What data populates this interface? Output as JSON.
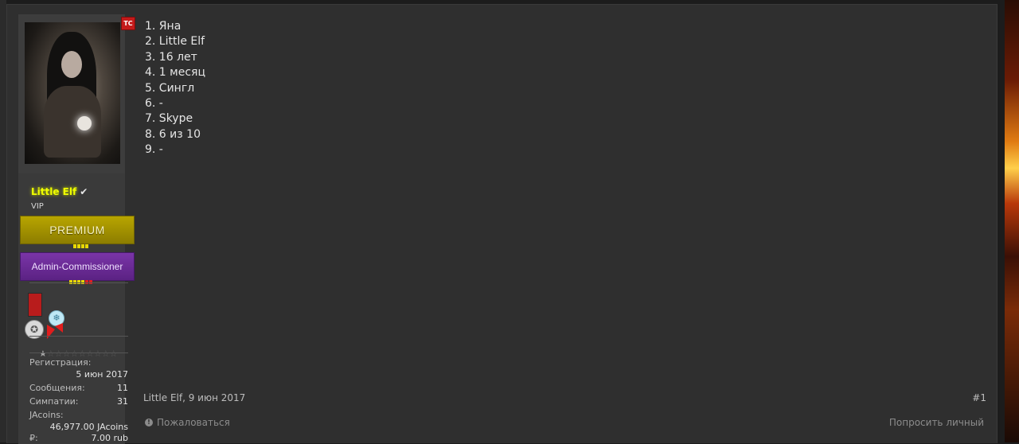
{
  "post": {
    "tc_badge": "ТС",
    "user": {
      "name": "Little Elf",
      "title": "VIP",
      "banner_premium": "PREMIUM",
      "banner_admin": "Admin-Commissioner",
      "rating_stars": 1,
      "rating_max": 10
    },
    "stats": {
      "reg_label": "Регистрация:",
      "reg_value": "5 июн 2017",
      "msgs_label": "Сообщения:",
      "msgs_value": "11",
      "likes_label": "Симпатии:",
      "likes_value": "31",
      "jacoins_label": "JAcoins:",
      "jacoins_value": "46,977.00 JAcoins",
      "rub_label": "₽:",
      "rub_value": "7.00 rub"
    },
    "content_lines": [
      "1. Яна",
      "2. Little Elf",
      "3. 16 лет",
      "4. 1 месяц",
      "5. Сингл",
      "6. -",
      "7. Skype",
      "8. 6 из 10",
      "9. -"
    ],
    "meta": {
      "author_date": "Little Elf, 9 июн 2017",
      "post_number": "#1",
      "report_label": "Пожаловаться",
      "pm_label": "Попросить личный"
    }
  },
  "colors": {
    "username": "#f0ff00",
    "premium": "#a89600",
    "admin": "#6a2c96",
    "tc_badge": "#c41a1a"
  },
  "icons": [
    "verified-check-icon",
    "info-icon",
    "medal-icon",
    "snowflake-icon",
    "star-icon"
  ]
}
